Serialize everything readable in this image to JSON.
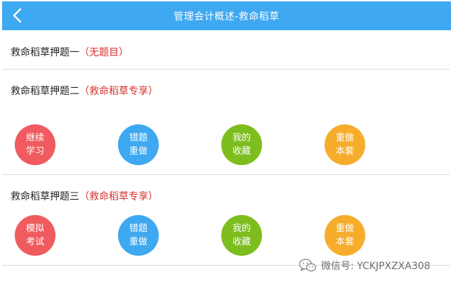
{
  "header": {
    "title": "管理会计概述-救命稻草",
    "back_icon": "chevron-left-icon",
    "color": "#3ea8f0"
  },
  "sections": [
    {
      "title": "救命稻草押题一",
      "highlight": "（无题目）"
    },
    {
      "title": "救命稻草押题二",
      "highlight": "（救命稻草专享）"
    },
    {
      "title": "救命稻草押题三",
      "highlight": "（救命稻草专享）"
    }
  ],
  "section2_buttons": [
    {
      "line1": "继续",
      "line2": "学习",
      "color": "#ef5b5e"
    },
    {
      "line1": "错题",
      "line2": "重做",
      "color": "#3ea8f0"
    },
    {
      "line1": "我的",
      "line2": "收藏",
      "color": "#7dbd1e"
    },
    {
      "line1": "重做",
      "line2": "本套",
      "color": "#f7ad2c"
    }
  ],
  "section3_buttons": [
    {
      "line1": "模拟",
      "line2": "考试",
      "color": "#ef5b5e"
    },
    {
      "line1": "错题",
      "line2": "重做",
      "color": "#3ea8f0"
    },
    {
      "line1": "我的",
      "line2": "收藏",
      "color": "#7dbd1e"
    },
    {
      "line1": "重做",
      "line2": "本套",
      "color": "#f7ad2c"
    }
  ],
  "watermark": {
    "text": "微信号: YCKJPXZXA308",
    "icon": "wechat-icon"
  }
}
